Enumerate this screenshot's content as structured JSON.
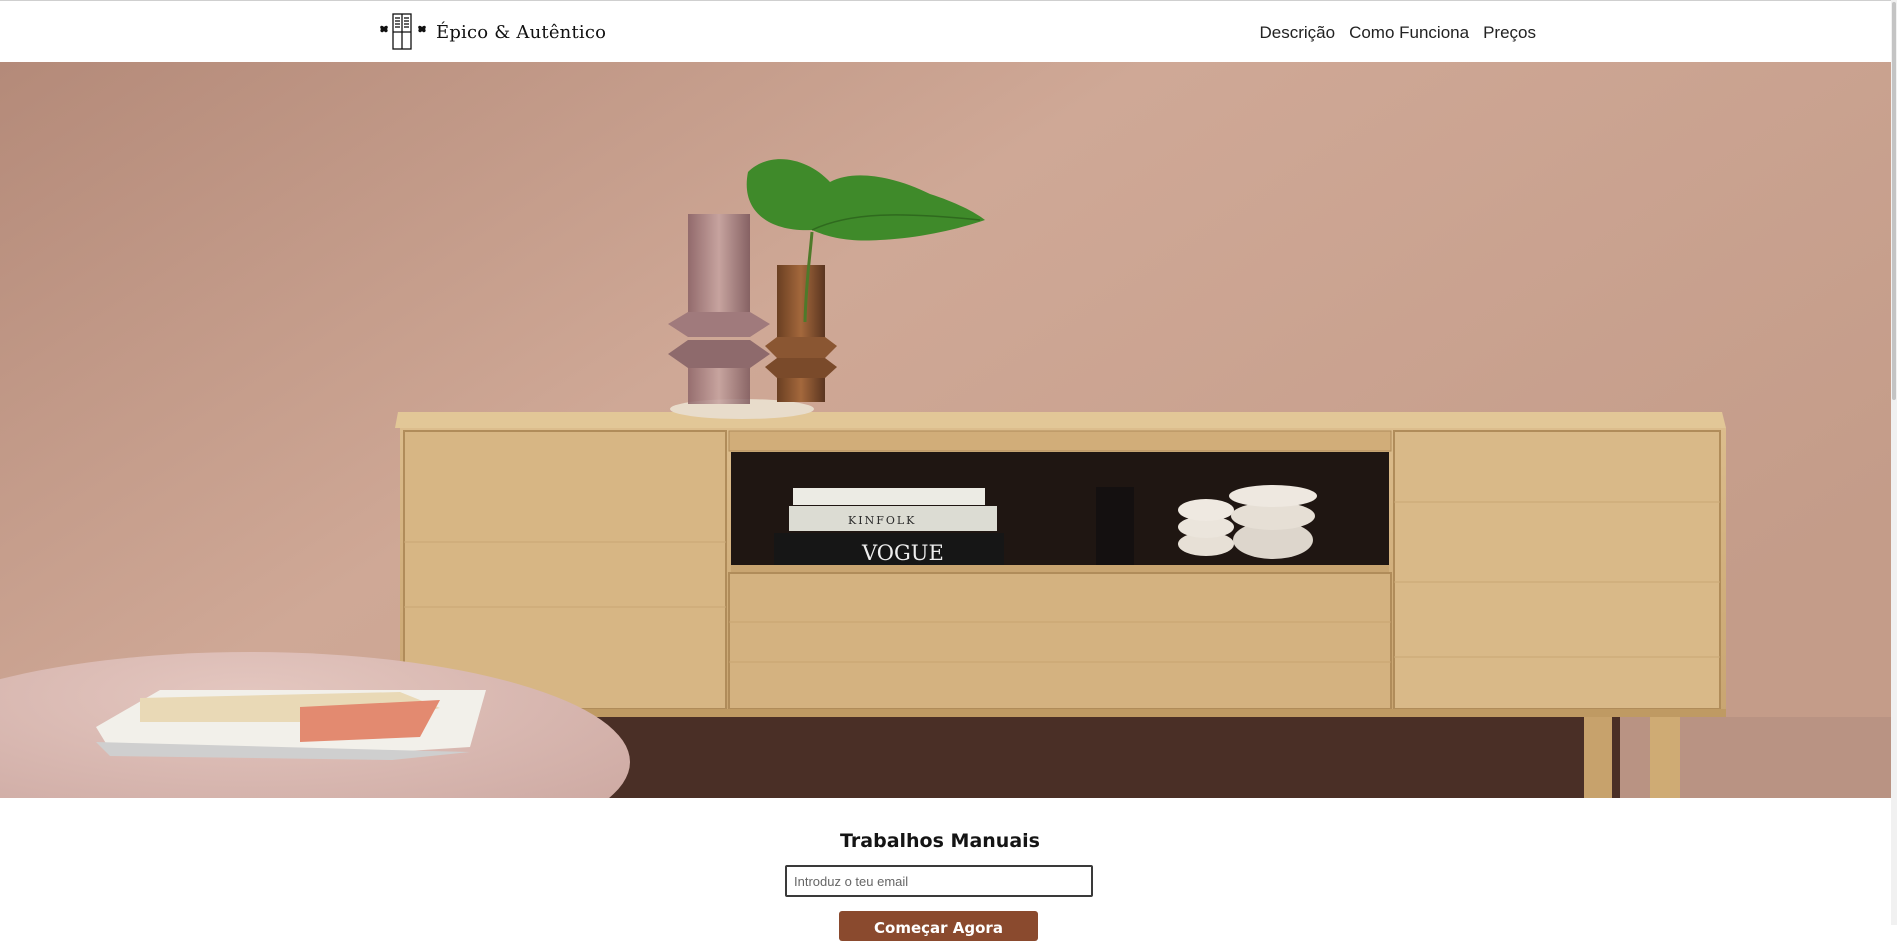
{
  "brand": {
    "name": "Épico & Autêntico",
    "icon": "wardrobe-logo-icon"
  },
  "nav": {
    "items": [
      "Descrição",
      "Como Funciona",
      "Preços"
    ]
  },
  "hero": {
    "image": "sideboard-hero-photo",
    "book_texts": [
      "KINFOLK",
      "VOGUE"
    ]
  },
  "signup": {
    "title": "Trabalhos Manuais",
    "email_placeholder": "Introduz o teu email",
    "email_value": "",
    "button_label": "Começar Agora"
  },
  "colors": {
    "button": "#8a4a2e",
    "wall": "#c9a08c",
    "wood": "#d6b583"
  }
}
